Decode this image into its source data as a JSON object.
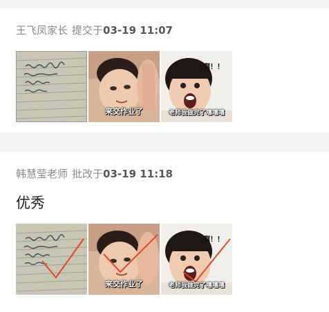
{
  "submission": {
    "author": "王飞凤家长",
    "action": "提交于",
    "time": "03-19 11:07",
    "attachments": [
      {
        "icon": "homework-photo",
        "caption": ""
      },
      {
        "icon": "meme-child-photo",
        "caption": "来交作业了"
      },
      {
        "icon": "meme-shock-photo",
        "caption_top": "啊！！",
        "caption": "老师我做完了嘻嘻嘻"
      }
    ]
  },
  "review": {
    "author": "韩慧莹老师",
    "action": "批改于",
    "time": "03-19 11:18",
    "comment": "优秀",
    "attachments": [
      {
        "icon": "homework-photo",
        "caption": ""
      },
      {
        "icon": "meme-child-photo",
        "caption": "来交作业了"
      },
      {
        "icon": "meme-shock-photo",
        "caption_top": "啊！！",
        "caption": "老师我做完了嘻嘻嘻"
      }
    ]
  },
  "colors": {
    "background_gap": "#f3f3f5",
    "meta_text": "#888888",
    "time_text": "#555555",
    "check_mark": "#e0462a"
  }
}
